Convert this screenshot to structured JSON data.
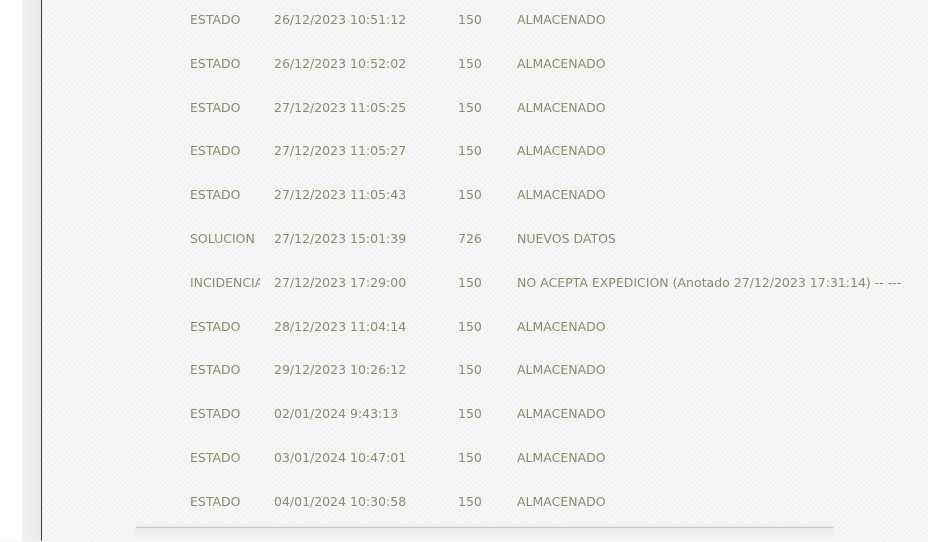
{
  "history": {
    "rows": [
      {
        "type": "ESTADO",
        "datetime": "26/12/2023 10:51:12",
        "code": "150",
        "description": "ALMACENADO"
      },
      {
        "type": "ESTADO",
        "datetime": "26/12/2023 10:52:02",
        "code": "150",
        "description": "ALMACENADO"
      },
      {
        "type": "ESTADO",
        "datetime": "27/12/2023 11:05:25",
        "code": "150",
        "description": "ALMACENADO"
      },
      {
        "type": "ESTADO",
        "datetime": "27/12/2023 11:05:27",
        "code": "150",
        "description": "ALMACENADO"
      },
      {
        "type": "ESTADO",
        "datetime": "27/12/2023 11:05:43",
        "code": "150",
        "description": "ALMACENADO"
      },
      {
        "type": "SOLUCION",
        "datetime": "27/12/2023 15:01:39",
        "code": "726",
        "description": "NUEVOS DATOS"
      },
      {
        "type": "INCIDENCIA",
        "datetime": "27/12/2023 17:29:00",
        "code": "150",
        "description": "NO ACEPTA EXPEDICION (Anotado 27/12/2023 17:31:14) -- ---"
      },
      {
        "type": "ESTADO",
        "datetime": "28/12/2023 11:04:14",
        "code": "150",
        "description": "ALMACENADO"
      },
      {
        "type": "ESTADO",
        "datetime": "29/12/2023 10:26:12",
        "code": "150",
        "description": "ALMACENADO"
      },
      {
        "type": "ESTADO",
        "datetime": "02/01/2024 9:43:13",
        "code": "150",
        "description": "ALMACENADO"
      },
      {
        "type": "ESTADO",
        "datetime": "03/01/2024 10:47:01",
        "code": "150",
        "description": "ALMACENADO"
      },
      {
        "type": "ESTADO",
        "datetime": "04/01/2024 10:30:58",
        "code": "150",
        "description": "ALMACENADO"
      }
    ]
  },
  "colors": {
    "text": "#8b8b6a",
    "panel_border": "#3a3a3a"
  }
}
